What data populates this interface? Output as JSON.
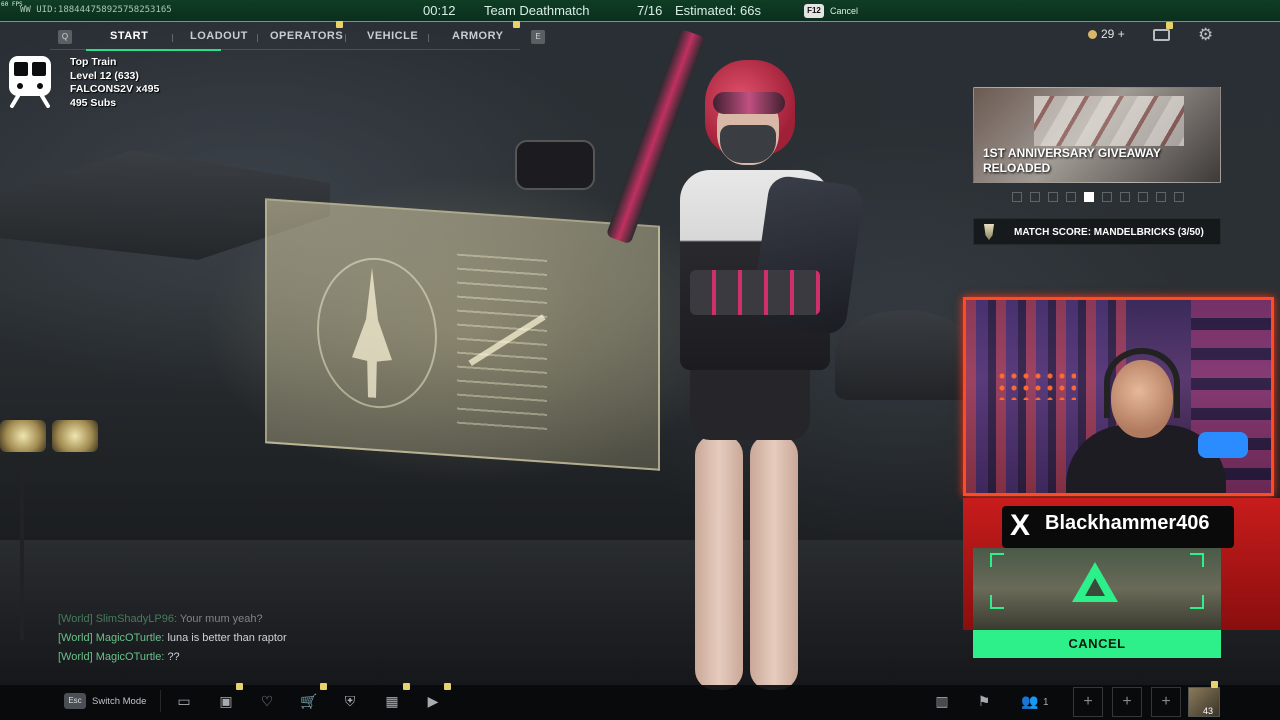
{
  "topbar": {
    "fps": "60 FPS",
    "uid": "WW UID:18844475892575825316​5",
    "timer": "00:12",
    "mode": "Team Deathmatch",
    "players": "7/16",
    "estimated": "Estimated: 66s",
    "cancel_key": "F12",
    "cancel_label": "Cancel"
  },
  "nav": {
    "left_key": "Q",
    "right_key": "E",
    "tabs": [
      {
        "label": "START"
      },
      {
        "label": "LOADOUT"
      },
      {
        "label": "OPERATORS"
      },
      {
        "label": "VEHICLE"
      },
      {
        "label": "ARMORY"
      }
    ]
  },
  "currency": {
    "coins": "29",
    "plus": "+"
  },
  "stream_info": {
    "title": "Top Train",
    "level": "Level 12  (633)",
    "sponsor": "FALCONS2V x495",
    "subs": "495 Subs"
  },
  "promo": {
    "title_line1": "1ST ANNIVERSARY GIVEAWAY",
    "title_line2": "RELOADED",
    "dots_total": 10,
    "dots_active": 4
  },
  "match_score": {
    "label": "MATCH SCORE: MANDELBRICKS (3/50)"
  },
  "streamer": {
    "name": "Blackhammer406",
    "social_glyph": "X"
  },
  "cancel_button": "CANCEL",
  "chat": [
    {
      "channel": "[World]",
      "user": "SlimShadyLP96:",
      "message": "Your mum yeah?",
      "faded": true
    },
    {
      "channel": "[World]",
      "user": "MagicOTurtle:",
      "message": "luna is better than raptor",
      "faded": false
    },
    {
      "channel": "[World]",
      "user": "MagicOTurtle:",
      "message": "??",
      "faded": false
    }
  ],
  "bottombar": {
    "esc_key": "Esc",
    "switch_mode": "Switch Mode",
    "party_count": "1",
    "avatar_badge": "43"
  },
  "colors": {
    "accent_green": "#2ef08a",
    "webcam_border": "#ff4a22",
    "pip_yellow": "#e8d36a"
  }
}
